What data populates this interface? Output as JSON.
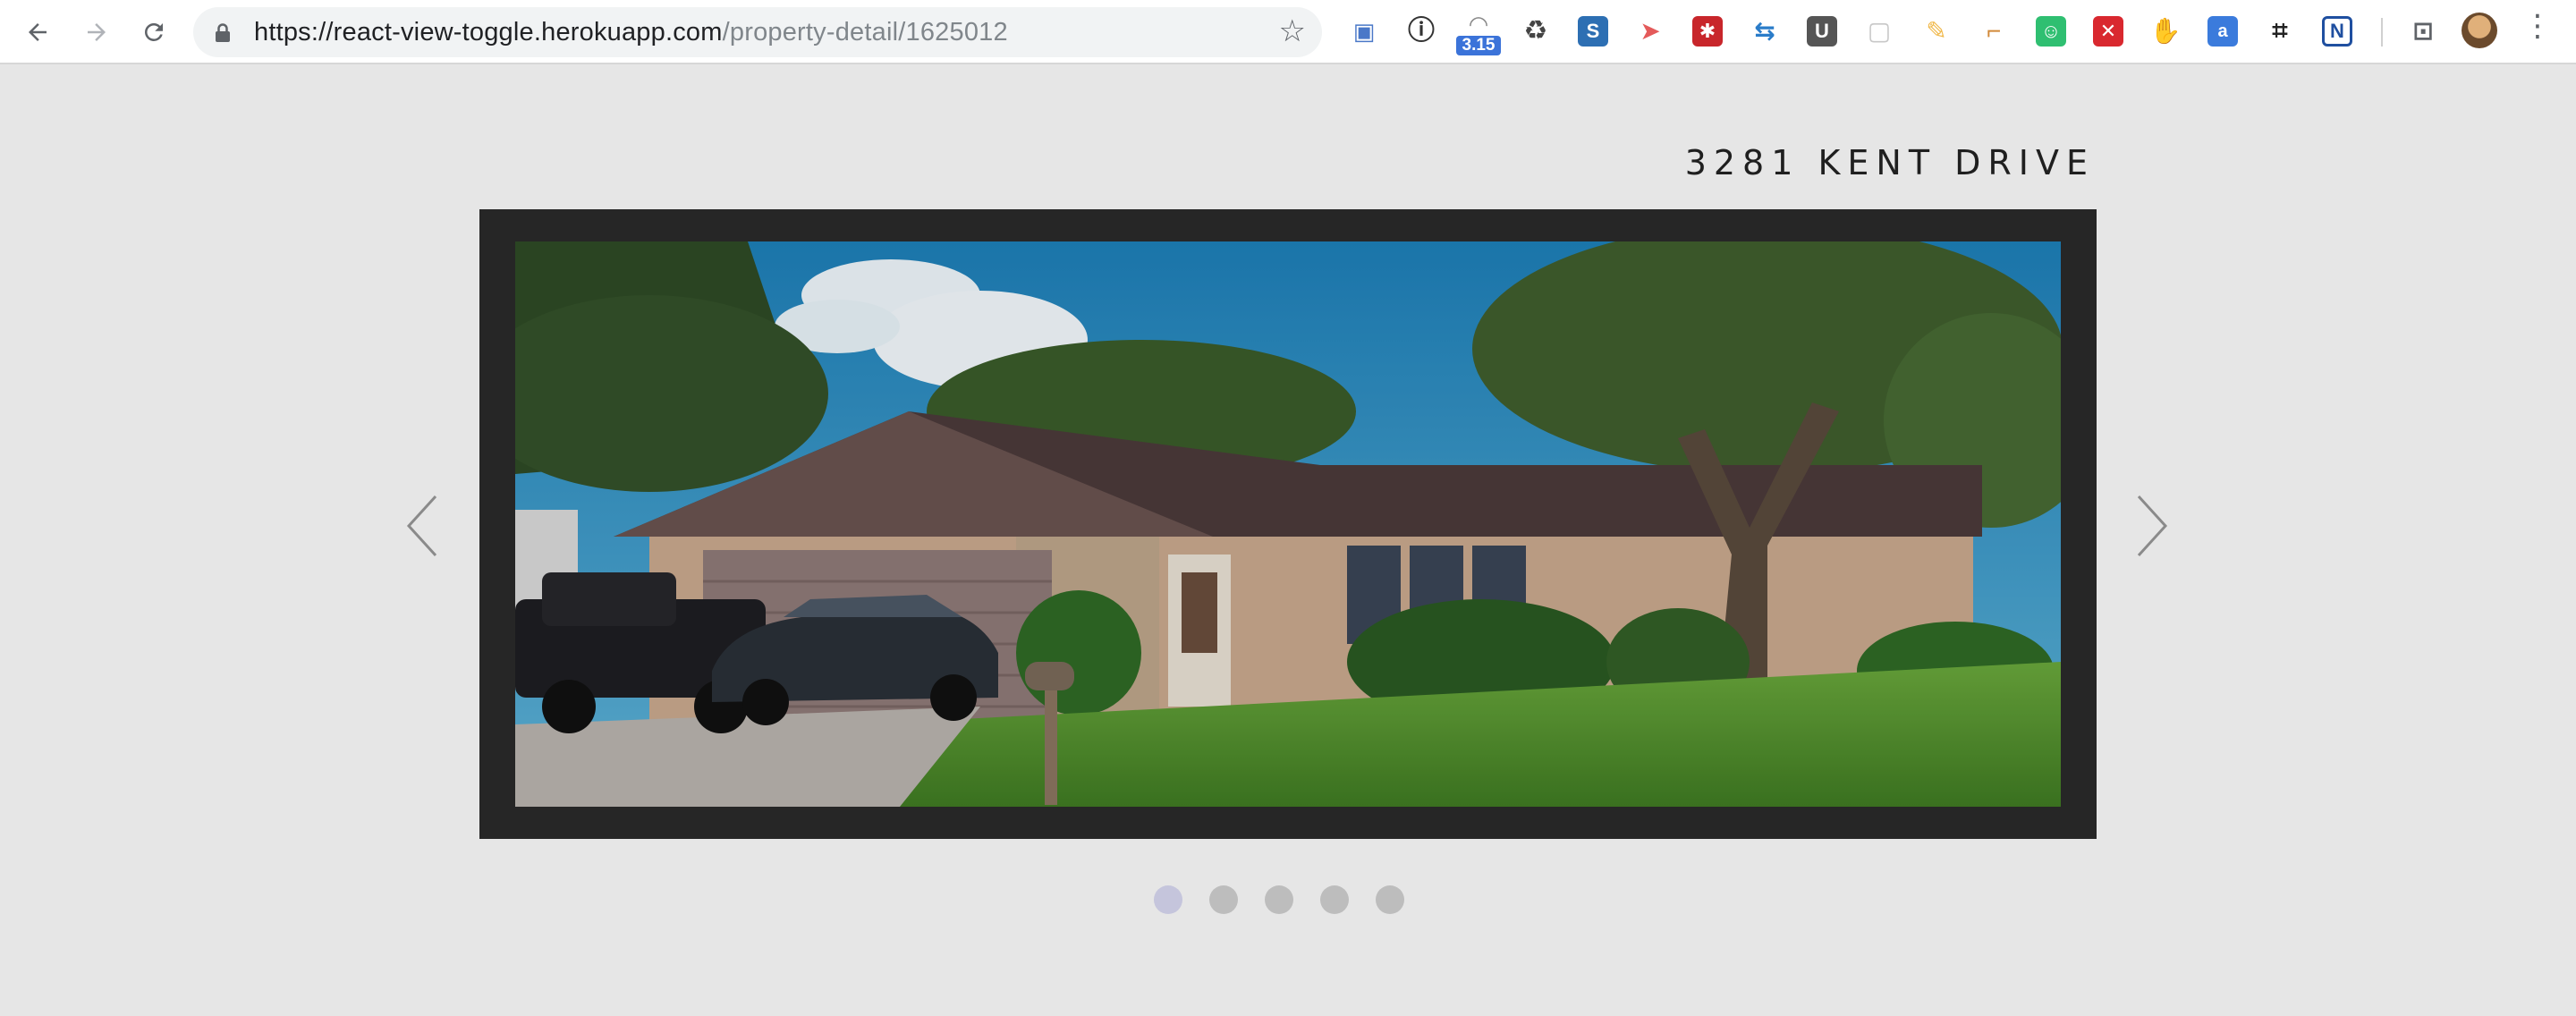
{
  "browser": {
    "url_host": "https://react-view-toggle.herokuapp.com",
    "url_path": "/property-detail/1625012",
    "extension_badge": "3.15",
    "extensions": [
      "folder-icon",
      "info-icon",
      "speedometer-icon",
      "recycle-icon",
      "s-logo-icon",
      "arrow-tag-icon",
      "puzzle-red-icon",
      "swap-arrows-icon",
      "u-logo-icon",
      "chat-icon",
      "pencil-icon",
      "ruler-icon",
      "smile-icon",
      "shield-icon",
      "hand-icon",
      "translate-icon",
      "crop-icon",
      "n-logo-icon",
      "cast-icon"
    ]
  },
  "property": {
    "address": "3281 KENT DRIVE"
  },
  "carousel": {
    "slide_count": 5,
    "active_index": 0,
    "prev_label": "‹",
    "next_label": "›"
  },
  "colors": {
    "page_bg": "#e6e6e6",
    "frame_bg": "#262626",
    "dot": "#bdbdbd",
    "dot_active": "#c5c5dc"
  }
}
